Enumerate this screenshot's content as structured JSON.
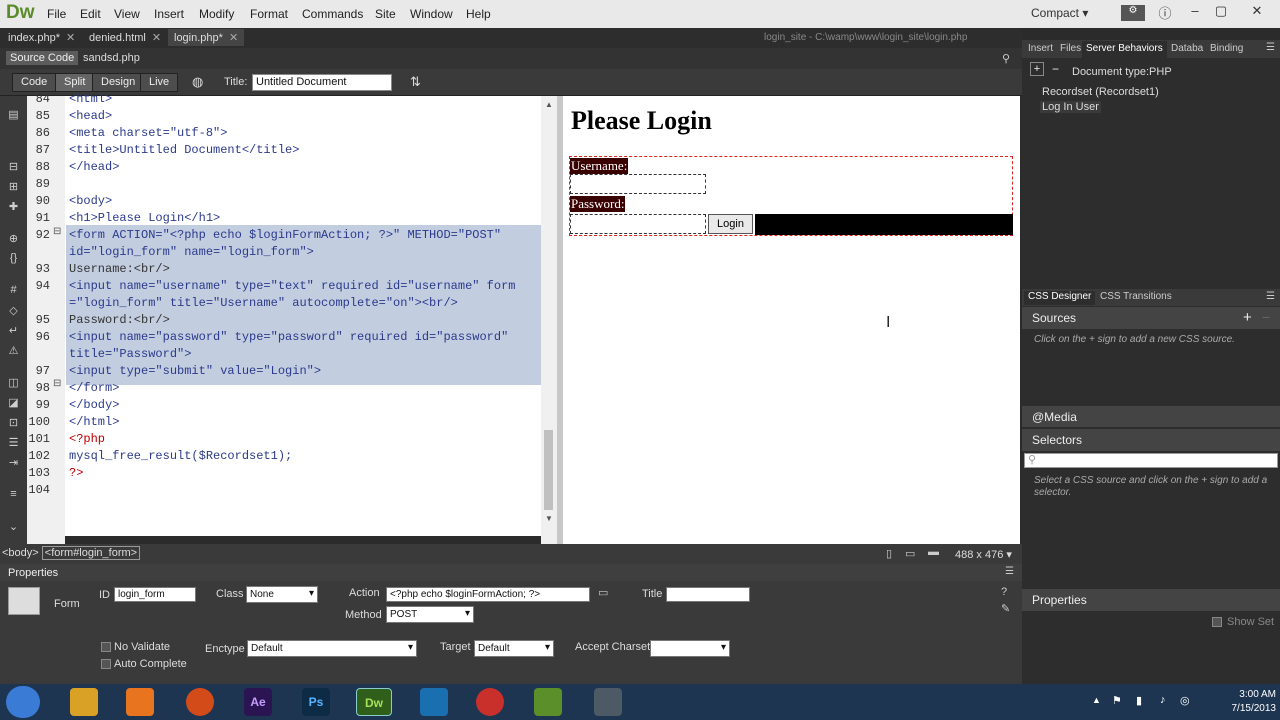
{
  "app": {
    "logo": "Dw"
  },
  "menu": [
    "File",
    "Edit",
    "View",
    "Insert",
    "Modify",
    "Format",
    "Commands",
    "Site",
    "Window",
    "Help"
  ],
  "workspace": "Compact",
  "tabs": [
    {
      "label": "index.php*"
    },
    {
      "label": "denied.html"
    },
    {
      "label": "login.php*"
    }
  ],
  "path": "login_site - C:\\wamp\\www\\login_site\\login.php",
  "related": {
    "source": "Source Code",
    "file": "sandsd.php"
  },
  "toolbar": {
    "code": "Code",
    "split": "Split",
    "design": "Design",
    "live": "Live",
    "title_label": "Title:",
    "title_value": "Untitled Document"
  },
  "code_lines": [
    {
      "n": "84",
      "text": "<html>"
    },
    {
      "n": "85",
      "text": "<head>"
    },
    {
      "n": "86",
      "text": "<meta charset=\"utf-8\">"
    },
    {
      "n": "87",
      "text": "<title>Untitled Document</title>"
    },
    {
      "n": "88",
      "text": "</head>"
    },
    {
      "n": "89",
      "text": ""
    },
    {
      "n": "90",
      "text": "<body>"
    },
    {
      "n": "91",
      "text": "<h1>Please Login</h1>"
    },
    {
      "n": "92",
      "text": "<form ACTION=\"<?php echo $loginFormAction; ?>\" METHOD=\"POST\""
    },
    {
      "n": "",
      "text": "id=\"login_form\" name=\"login_form\">"
    },
    {
      "n": "93",
      "text": "Username:<br/>"
    },
    {
      "n": "94",
      "text": "<input name=\"username\" type=\"text\" required id=\"username\" form"
    },
    {
      "n": "",
      "text": "=\"login_form\" title=\"Username\" autocomplete=\"on\"><br/>"
    },
    {
      "n": "95",
      "text": "Password:<br/>"
    },
    {
      "n": "96",
      "text": "<input name=\"password\" type=\"password\" required id=\"password\""
    },
    {
      "n": "",
      "text": "title=\"Password\">"
    },
    {
      "n": "97",
      "text": "<input type=\"submit\" value=\"Login\">"
    },
    {
      "n": "98",
      "text": "</form>"
    },
    {
      "n": "99",
      "text": "</body>"
    },
    {
      "n": "100",
      "text": "</html>"
    },
    {
      "n": "101",
      "text": "<?php"
    },
    {
      "n": "102",
      "text": "mysql_free_result($Recordset1);"
    },
    {
      "n": "103",
      "text": "?>"
    },
    {
      "n": "104",
      "text": ""
    }
  ],
  "design": {
    "heading": "Please Login",
    "username_label": "Username:",
    "password_label": "Password:",
    "login_button": "Login"
  },
  "status": {
    "tag_selector_body": "<body>",
    "tag_selector_form": "<form#login_form>",
    "dims": "488 x 476"
  },
  "properties": {
    "title": "Properties",
    "element": "Form",
    "id_label": "ID",
    "id_value": "login_form",
    "class_label": "Class",
    "class_value": "None",
    "action_label": "Action",
    "action_value": "<?php echo $loginFormAction; ?>",
    "title_label": "Title",
    "title_value": "",
    "method_label": "Method",
    "method_value": "POST",
    "no_validate": "No Validate",
    "auto_complete": "Auto Complete",
    "enctype_label": "Enctype",
    "enctype_value": "Default",
    "target_label": "Target",
    "target_value": "Default",
    "accept_charset_label": "Accept Charset",
    "accept_charset_value": ""
  },
  "right_panel": {
    "tabs": [
      "Insert",
      "Files",
      "Server Behaviors",
      "Databa",
      "Binding"
    ],
    "doc_type": "Document type:PHP",
    "behaviors": [
      "Recordset (Recordset1)",
      "Log In User"
    ],
    "css_tabs": [
      "CSS Designer",
      "CSS Transitions"
    ],
    "sources": "Sources",
    "sources_hint": "Click on the + sign to add a new CSS source.",
    "media": "@Media",
    "selectors": "Selectors",
    "selectors_hint": "Select a CSS source and click on the + sign to add a selector.",
    "properties": "Properties",
    "show_set": "Show Set"
  },
  "clock": {
    "time": "3:00 AM",
    "date": "7/15/2013"
  },
  "taskbar": [
    "Ae",
    "Ps",
    "Dw"
  ]
}
